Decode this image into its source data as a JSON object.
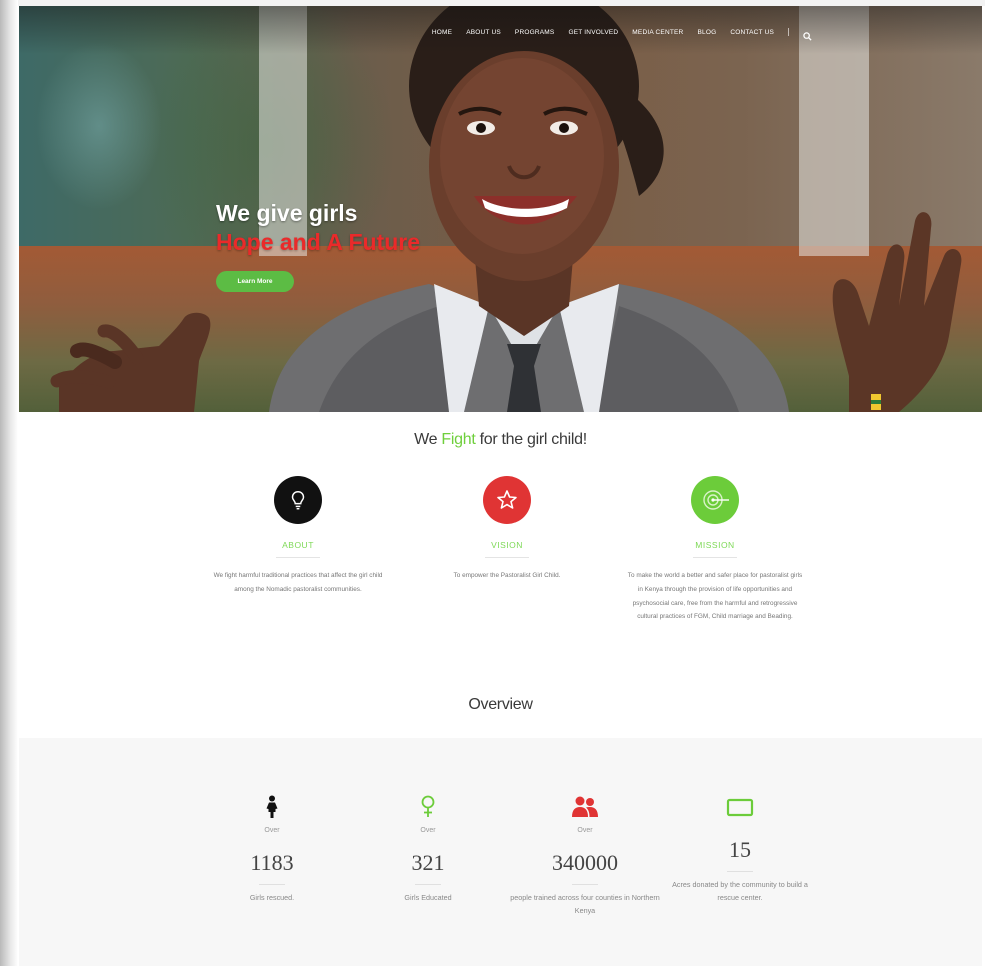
{
  "nav": {
    "items": [
      "HOME",
      "ABOUT US",
      "PROGRAMS",
      "GET INVOLVED",
      "MEDIA CENTER",
      "BLOG",
      "CONTACT US"
    ]
  },
  "hero": {
    "line1": "We give girls",
    "line2": "Hope and A Future",
    "button_label": "Learn More"
  },
  "mission": {
    "title_prefix": "We ",
    "title_accent": "Fight",
    "title_suffix": " for the girl child!",
    "features": [
      {
        "icon": "lightbulb-icon",
        "color": "#111111",
        "title": "ABOUT",
        "text": "We fight harmful traditional practices that affect the girl child among the Nomadic pastoralist communities."
      },
      {
        "icon": "star-icon",
        "color": "#e03434",
        "title": "VISION",
        "text": "To empower the Pastoralist Girl Child."
      },
      {
        "icon": "target-icon",
        "color": "#6ccc3a",
        "title": "MISSION",
        "text": "To make the world a better and safer place for pastoralist girls in Kenya through the provision of life opportunities and psychosocial care, free from the harmful and retrogressive cultural practices of FGM, Child marriage and Beading."
      }
    ]
  },
  "overview": {
    "title": "Overview",
    "stats": [
      {
        "icon": "girl-icon",
        "color": "#111111",
        "prefix": "Over",
        "number": "1183",
        "desc": "Girls rescued."
      },
      {
        "icon": "female-symbol-icon",
        "color": "#6ccc3a",
        "prefix": "Over",
        "number": "321",
        "desc": "Girls Educated"
      },
      {
        "icon": "people-icon",
        "color": "#e03434",
        "prefix": "Over",
        "number": "340000",
        "desc": "people trained across four counties in Northern Kenya"
      },
      {
        "icon": "rectangle-icon",
        "color": "#6ccc3a",
        "prefix": "",
        "number": "15",
        "desc": "Acres donated by the community to build a rescue center."
      }
    ]
  }
}
